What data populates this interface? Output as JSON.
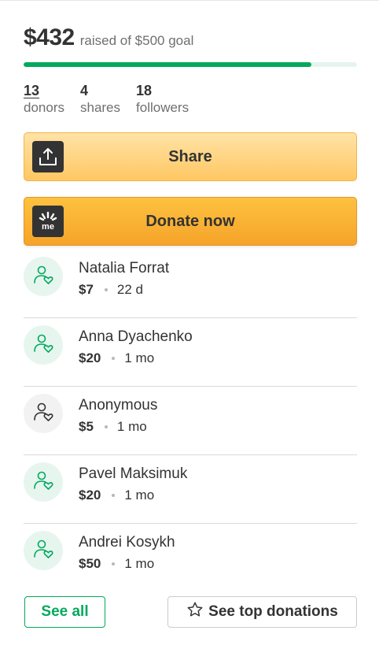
{
  "fundraiser": {
    "raised": "$432",
    "goal_text": "raised of $500 goal",
    "progress_fraction": 0.864
  },
  "stats": [
    {
      "value": "13",
      "label": "donors"
    },
    {
      "value": "4",
      "label": "shares"
    },
    {
      "value": "18",
      "label": "followers"
    }
  ],
  "actions": {
    "share_label": "Share",
    "donate_label": "Donate now",
    "donate_icon_text": "me"
  },
  "donations": [
    {
      "name": "Natalia Forrat",
      "amount": "$7",
      "time": "22 d"
    },
    {
      "name": "Anna Dyachenko",
      "amount": "$20",
      "time": "1 mo"
    },
    {
      "name": "Anonymous",
      "amount": "$5",
      "time": "1 mo"
    },
    {
      "name": "Pavel Maksimuk",
      "amount": "$20",
      "time": "1 mo"
    },
    {
      "name": "Andrei Kosykh",
      "amount": "$50",
      "time": "1 mo"
    }
  ],
  "footer": {
    "see_all_label": "See all",
    "see_top_label": "See top donations"
  },
  "colors": {
    "accent_green": "#02a95c",
    "share_button": "#ffc763",
    "donate_button": "#f5a429",
    "text": "#333333"
  },
  "icons": {
    "share": "share-upload-icon",
    "donate": "gofundme-logo-icon",
    "donor": "person-heart-icon",
    "top_donations": "star-icon"
  }
}
